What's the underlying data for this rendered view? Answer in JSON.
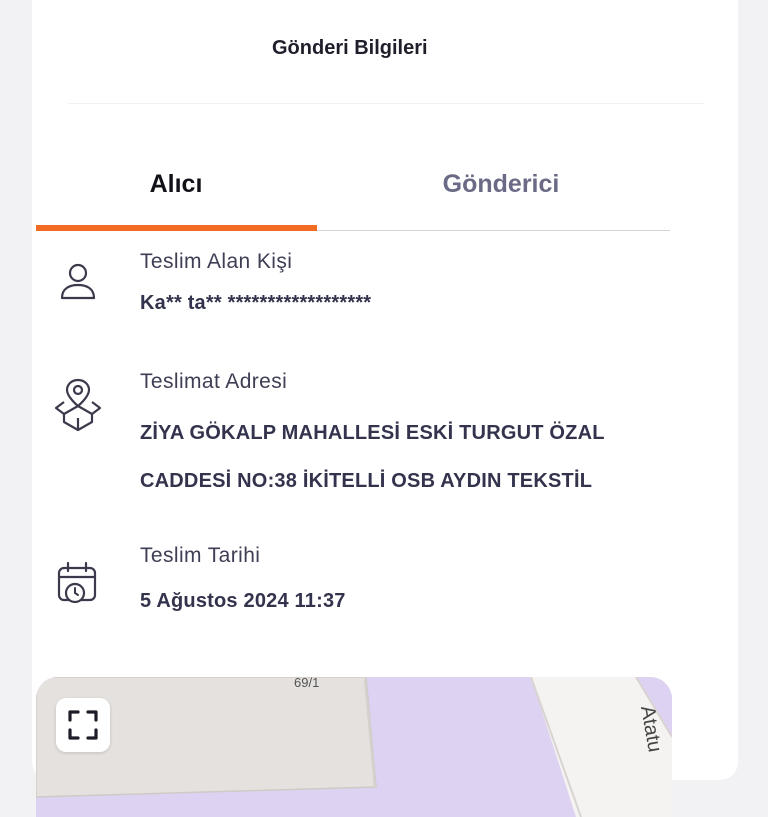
{
  "header": {
    "title": "Gönderi Bilgileri"
  },
  "tabs": [
    {
      "label": "Alıcı",
      "active": true
    },
    {
      "label": "Gönderici",
      "active": false
    }
  ],
  "recipient": {
    "person": {
      "label": "Teslim Alan Kişi",
      "value": "Ka** ta** ******************",
      "icon": "user-icon"
    },
    "address": {
      "label": "Teslimat Adresi",
      "line1": "ZİYA GÖKALP MAHALLESİ ESKİ TURGUT ÖZAL",
      "line2": "CADDESİ NO:38 İKİTELLİ OSB AYDIN TEKSTİL",
      "icon": "map-box-icon"
    },
    "date": {
      "label": "Teslim Tarihi",
      "value": "5 Ağustos 2024 11:37",
      "icon": "calendar-clock-icon"
    }
  },
  "map": {
    "building_number": "69/1",
    "street_label": "Atatu",
    "expand_icon": "expand-icon"
  },
  "colors": {
    "accent": "#f26b22",
    "text_dark": "#33334d",
    "map_purple": "#ddd2f2",
    "map_building": "#e2e0dd"
  }
}
